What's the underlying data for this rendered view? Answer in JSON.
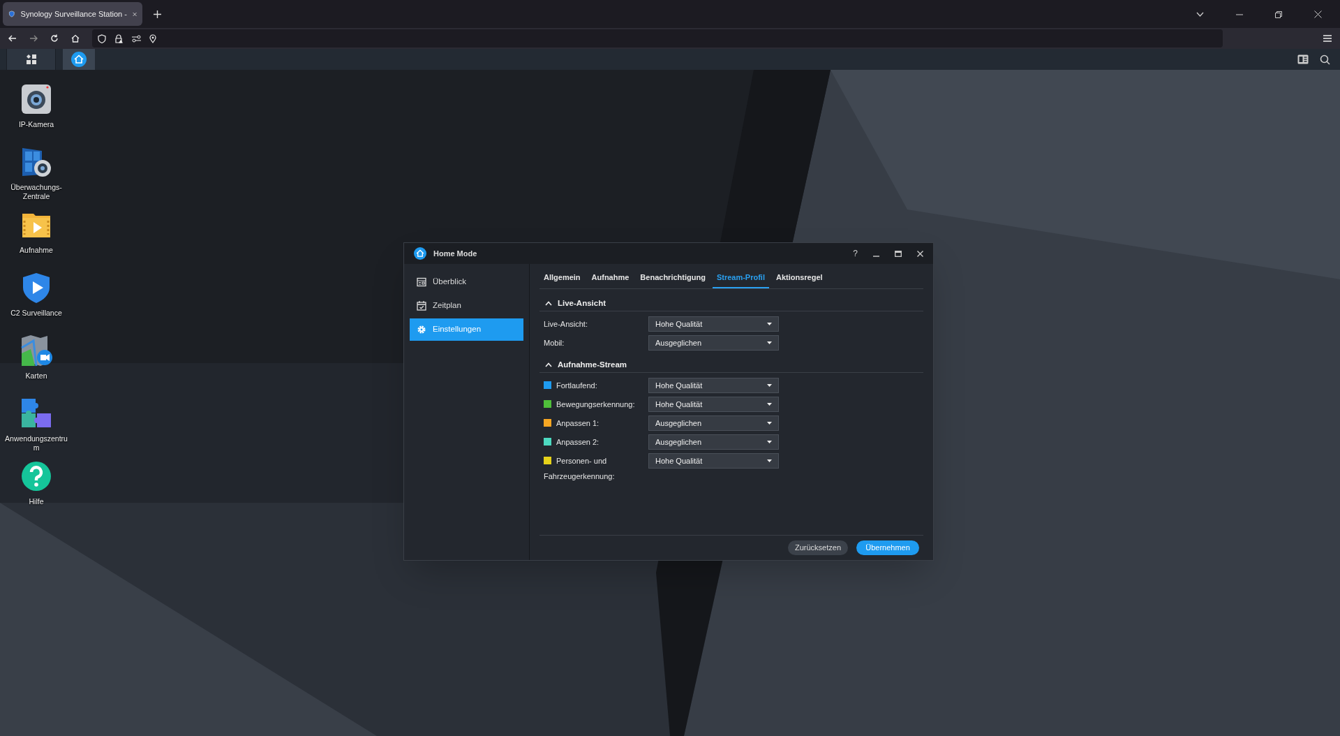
{
  "browser": {
    "tab": {
      "title": "Synology Surveillance Station -"
    }
  },
  "desktop_icons": [
    {
      "kind": "camera",
      "label": "IP-Kamera"
    },
    {
      "kind": "monitor",
      "label": "Überwachungs-Zentrale"
    },
    {
      "kind": "folder",
      "label": "Aufnahme"
    },
    {
      "kind": "shield",
      "label": "C2 Surveillance"
    },
    {
      "kind": "map",
      "label": "Karten"
    },
    {
      "kind": "puzzle",
      "label": "Anwendungszentrum"
    },
    {
      "kind": "help",
      "label": "Hilfe"
    }
  ],
  "dialog": {
    "title": "Home Mode",
    "help": "?",
    "sidebar": [
      {
        "kind": "overview",
        "label": "Überblick",
        "selected": false
      },
      {
        "kind": "calendar",
        "label": "Zeitplan",
        "selected": false
      },
      {
        "kind": "gear",
        "label": "Einstellungen",
        "selected": true
      }
    ],
    "tabs": [
      {
        "label": "Allgemein",
        "selected": false
      },
      {
        "label": "Aufnahme",
        "selected": false
      },
      {
        "label": "Benachrichtigung",
        "selected": false
      },
      {
        "label": "Stream-Profil",
        "selected": true
      },
      {
        "label": "Aktionsregel",
        "selected": false
      }
    ],
    "sections": [
      {
        "title": "Live-Ansicht",
        "expanded": true,
        "rows": [
          {
            "label": "Live-Ansicht:",
            "value": "Hohe Qualität"
          },
          {
            "label": "Mobil:",
            "value": "Ausgeglichen"
          }
        ]
      },
      {
        "title": "Aufnahme-Stream",
        "expanded": true,
        "rows": [
          {
            "label": "Fortlaufend:",
            "value": "Hohe Qualität",
            "color": "#1e9bf0"
          },
          {
            "label": "Bewegungserkennung:",
            "value": "Hohe Qualität",
            "color": "#4fbf3a"
          },
          {
            "label": "Anpassen 1:",
            "value": "Ausgeglichen",
            "color": "#f5a623"
          },
          {
            "label": "Anpassen 2:",
            "value": "Ausgeglichen",
            "color": "#4dd9c0"
          },
          {
            "label": "Personen- und Fahrzeugerkennung:",
            "value": "Hohe Qualität",
            "color": "#e6d21a"
          }
        ]
      }
    ],
    "buttons": [
      {
        "kind": "secondary",
        "label": "Zurücksetzen"
      },
      {
        "kind": "primary",
        "label": "Übernehmen"
      }
    ]
  }
}
